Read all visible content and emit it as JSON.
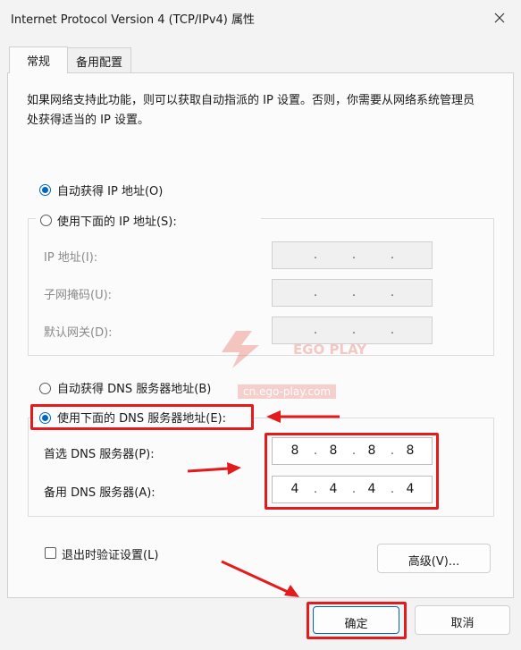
{
  "window": {
    "title": "Internet Protocol Version 4 (TCP/IPv4) 属性"
  },
  "tabs": [
    {
      "label": "常规",
      "active": true
    },
    {
      "label": "备用配置",
      "active": false
    }
  ],
  "description": "如果网络支持此功能，则可以获取自动指派的 IP 设置。否则，你需要从网络系统管理员处获得适当的 IP 设置。",
  "ip_section": {
    "auto_label": "自动获得 IP 地址(O)",
    "auto_selected": true,
    "manual_label": "使用下面的 IP 地址(S):",
    "fields": [
      {
        "label": "IP 地址(I):",
        "value": ". . ."
      },
      {
        "label": "子网掩码(U):",
        "value": ". . ."
      },
      {
        "label": "默认网关(D):",
        "value": ". . ."
      }
    ]
  },
  "dns_section": {
    "auto_label": "自动获得 DNS 服务器地址(B)",
    "manual_label": "使用下面的 DNS 服务器地址(E):",
    "manual_selected": true,
    "preferred": {
      "label": "首选 DNS 服务器(P):",
      "octets": [
        "8",
        "8",
        "8",
        "8"
      ]
    },
    "alternate": {
      "label": "备用 DNS 服务器(A):",
      "octets": [
        "4",
        "4",
        "4",
        "4"
      ]
    }
  },
  "validate": {
    "label": "退出时验证设置(L)",
    "checked": false
  },
  "advanced_label": "高级(V)...",
  "ok_label": "确定",
  "cancel_label": "取消",
  "watermark": {
    "brand": "EGO PLAY",
    "url": "cn.ego-play.com"
  },
  "colors": {
    "accent": "#0067c0",
    "annotation": "#e31b1b"
  }
}
